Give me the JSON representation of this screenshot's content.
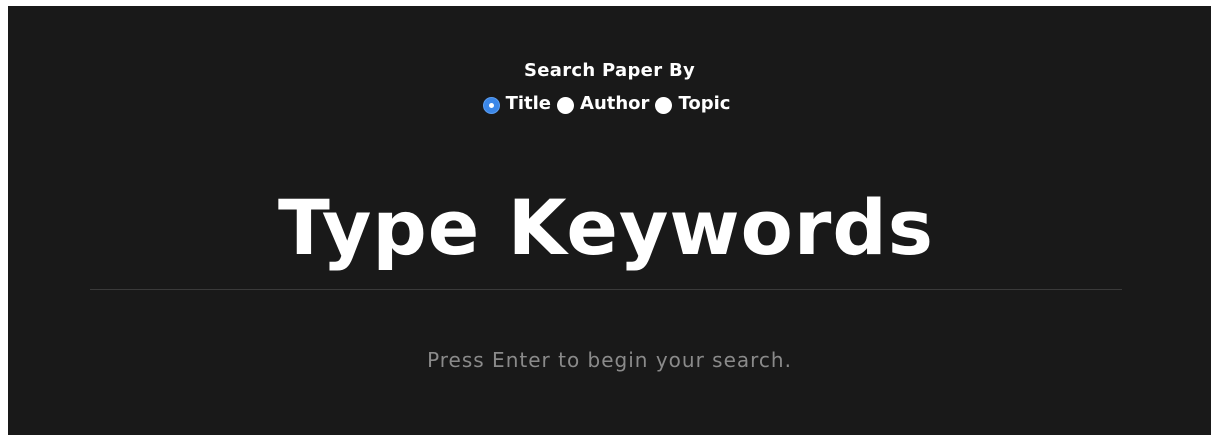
{
  "search_by": {
    "heading": "Search Paper By",
    "options": [
      {
        "label": "Title",
        "checked": true
      },
      {
        "label": "Author",
        "checked": false
      },
      {
        "label": "Topic",
        "checked": false
      }
    ]
  },
  "search": {
    "placeholder": "Type Keywords",
    "value": ""
  },
  "hint": "Press Enter to begin your search.",
  "colors": {
    "background": "#191919",
    "text": "#ffffff",
    "hint": "#8a8a8a",
    "radio_checked": "#3b87e8"
  }
}
